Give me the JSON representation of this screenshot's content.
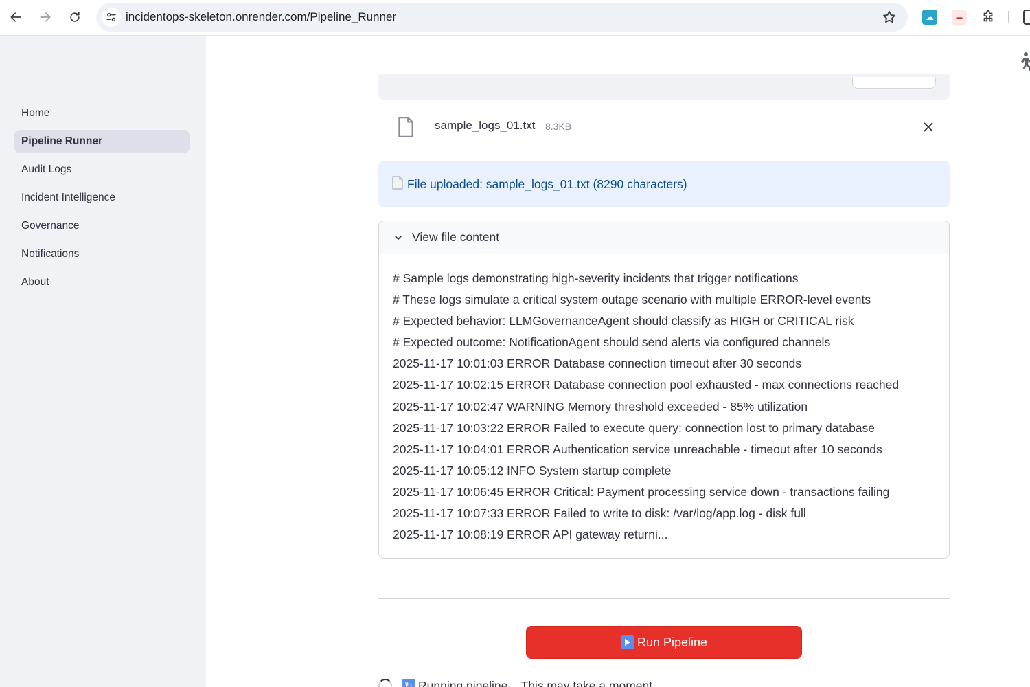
{
  "browser": {
    "url": "incidentops-skeleton.onrender.com/Pipeline_Runner"
  },
  "sidebar": {
    "items": [
      {
        "label": "Home",
        "active": false
      },
      {
        "label": "Pipeline Runner",
        "active": true
      },
      {
        "label": "Audit Logs",
        "active": false
      },
      {
        "label": "Incident Intelligence",
        "active": false
      },
      {
        "label": "Governance",
        "active": false
      },
      {
        "label": "Notifications",
        "active": false
      },
      {
        "label": "About",
        "active": false
      }
    ]
  },
  "upload": {
    "file_name": "sample_logs_01.txt",
    "file_size": "8.3KB",
    "success_message": "File uploaded: sample_logs_01.txt (8290 characters)"
  },
  "file_view": {
    "title": "View file content",
    "lines": [
      "# Sample logs demonstrating high-severity incidents that trigger notifications",
      "# These logs simulate a critical system outage scenario with multiple ERROR-level events",
      "# Expected behavior: LLMGovernanceAgent should classify as HIGH or CRITICAL risk",
      "# Expected outcome: NotificationAgent should send alerts via configured channels",
      "2025-11-17 10:01:03 ERROR Database connection timeout after 30 seconds",
      "2025-11-17 10:02:15 ERROR Database connection pool exhausted - max connections reached",
      "2025-11-17 10:02:47 WARNING Memory threshold exceeded - 85% utilization",
      "2025-11-17 10:03:22 ERROR Failed to execute query: connection lost to primary database",
      "2025-11-17 10:04:01 ERROR Authentication service unreachable - timeout after 10 seconds",
      "2025-11-17 10:05:12 INFO System startup complete",
      "2025-11-17 10:06:45 ERROR Critical: Payment processing service down - transactions failing",
      "2025-11-17 10:07:33 ERROR Failed to write to disk: /var/log/app.log - disk full",
      "2025-11-17 10:08:19 ERROR API gateway returni..."
    ]
  },
  "actions": {
    "run_label": "Run Pipeline",
    "running_message": "Running pipeline... This may take a moment."
  },
  "colors": {
    "primary": "#e8302a",
    "info_bg": "#e8f1fd",
    "info_text": "#0d4d8b",
    "sidebar_bg": "#f0f2f6"
  }
}
